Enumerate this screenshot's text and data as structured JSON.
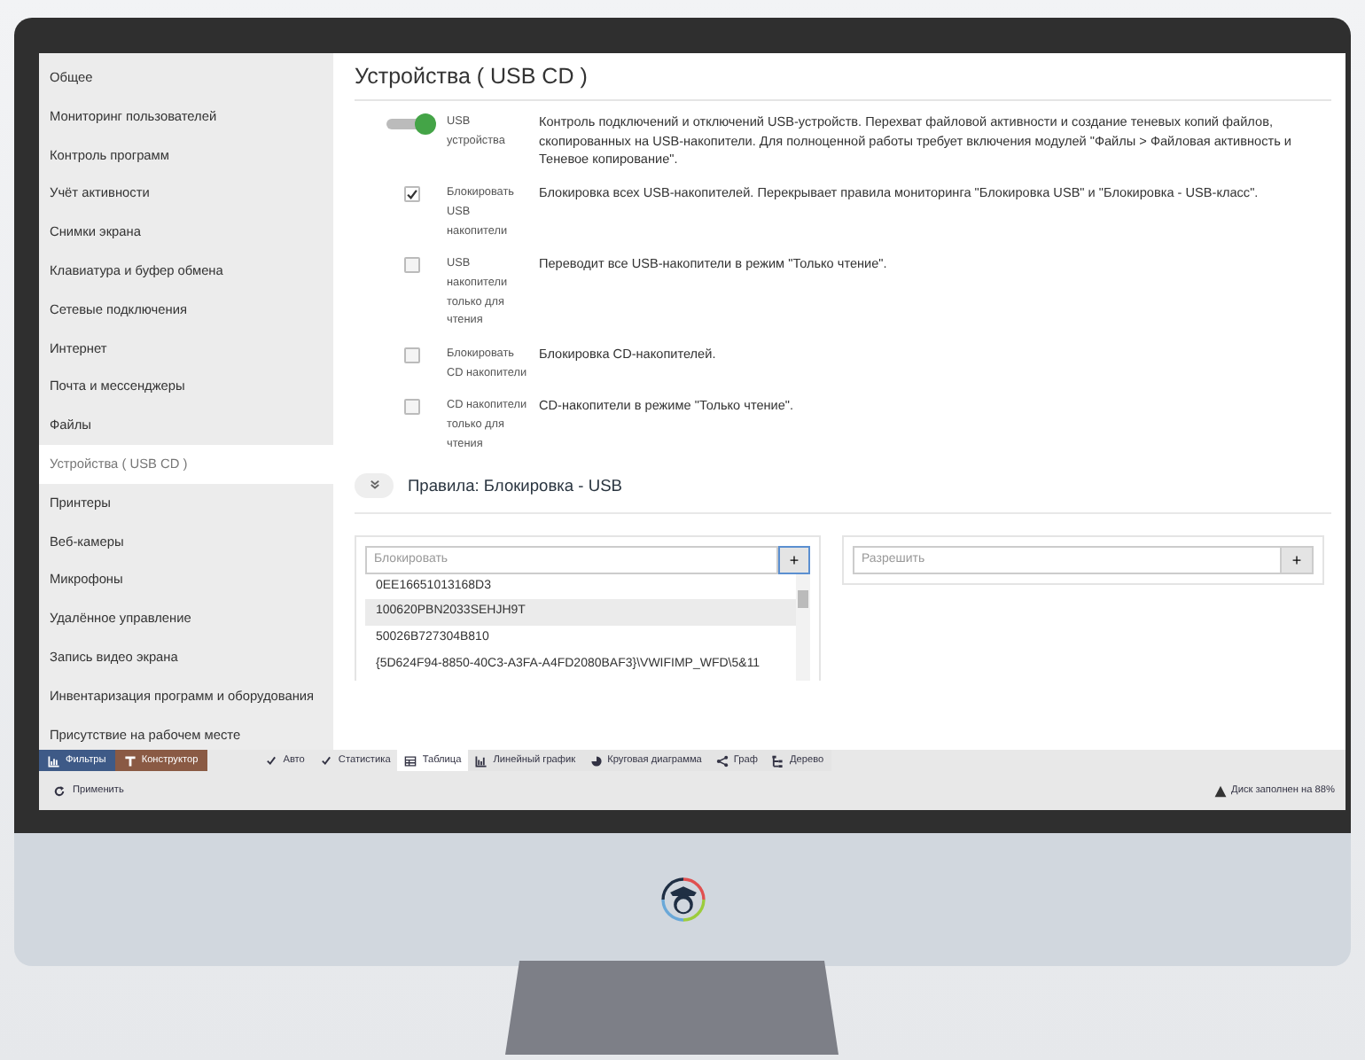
{
  "sidebar": {
    "items": [
      {
        "label": "Общее",
        "selected": false
      },
      {
        "label": "Мониторинг пользователей",
        "selected": false
      },
      {
        "label": "Контроль программ",
        "selected": false
      },
      {
        "label": "Учёт активности",
        "selected": false
      },
      {
        "label": "Снимки экрана",
        "selected": false
      },
      {
        "label": "Клавиатура и буфер обмена",
        "selected": false
      },
      {
        "label": "Сетевые подключения",
        "selected": false
      },
      {
        "label": "Интернет",
        "selected": false
      },
      {
        "label": "Почта и мессенджеры",
        "selected": false
      },
      {
        "label": "Файлы",
        "selected": false
      },
      {
        "label": "Устройства ( USB CD )",
        "selected": true
      },
      {
        "label": "Принтеры",
        "selected": false
      },
      {
        "label": "Веб-камеры",
        "selected": false
      },
      {
        "label": "Микрофоны",
        "selected": false
      },
      {
        "label": "Удалённое управление",
        "selected": false
      },
      {
        "label": "Запись видео экрана",
        "selected": false
      },
      {
        "label": "Инвентаризация программ и оборудования",
        "selected": false
      },
      {
        "label": "Присутствие на рабочем месте",
        "selected": false
      }
    ]
  },
  "page": {
    "title": "Устройства ( USB CD )"
  },
  "settings": [
    {
      "kind": "toggle",
      "on": true,
      "label": "USB устройства",
      "description": "Контроль подключений и отключений USB-устройств. Перехват файловой активности и создание теневых копий файлов, скопированных на USB-накопители. Для полноценной работы требует включения модулей \"Файлы > Файловая активность и Теневое копирование\"."
    },
    {
      "kind": "checkbox",
      "checked": true,
      "label": "Блокировать USB накопители",
      "description": "Блокировка всех USB-накопителей. Перекрывает правила мониторинга \"Блокировка USB\" и \"Блокировка - USB-класс\"."
    },
    {
      "kind": "checkbox",
      "checked": false,
      "label": "USB накопители только для чтения",
      "description": "Переводит все USB-накопители в режим \"Только чтение\"."
    },
    {
      "kind": "checkbox",
      "checked": false,
      "label": "Блокировать CD накопители",
      "description": "Блокировка CD-накопителей."
    },
    {
      "kind": "checkbox",
      "checked": false,
      "label": "CD накопители только для чтения",
      "description": "CD-накопители в режиме \"Только чтение\"."
    }
  ],
  "rules": {
    "title": "Правила: Блокировка - USB"
  },
  "block_list": {
    "placeholder": "Блокировать",
    "add_button": "+",
    "items": [
      {
        "text": "0EE16651013168D3",
        "selected": false
      },
      {
        "text": "100620PBN2033SEHJH9T",
        "selected": true
      },
      {
        "text": "50026B727304B810",
        "selected": false
      },
      {
        "text": "{5D624F94-8850-40C3-A3FA-A4FD2080BAF3}\\VWIFIMP_WFD\\5&11",
        "selected": false
      }
    ]
  },
  "allow_list": {
    "placeholder": "Разрешить",
    "add_button": "+"
  },
  "toolbar": {
    "buttons": [
      {
        "kind": "filters",
        "label": "Фильтры"
      },
      {
        "kind": "constructor",
        "label": "Конструктор"
      }
    ],
    "options": [
      {
        "label": "Авто",
        "checked": true
      },
      {
        "label": "Статистика",
        "checked": true
      }
    ],
    "views": [
      {
        "kind": "table",
        "label": "Таблица",
        "selected": true
      },
      {
        "kind": "line",
        "label": "Линейный график",
        "selected": false
      },
      {
        "kind": "pie",
        "label": "Круговая диаграмма",
        "selected": false
      },
      {
        "kind": "graph",
        "label": "Граф",
        "selected": false
      },
      {
        "kind": "tree",
        "label": "Дерево",
        "selected": false
      }
    ]
  },
  "status_bar": {
    "apply": "Применить",
    "disk": "Диск заполнен на 88%"
  }
}
